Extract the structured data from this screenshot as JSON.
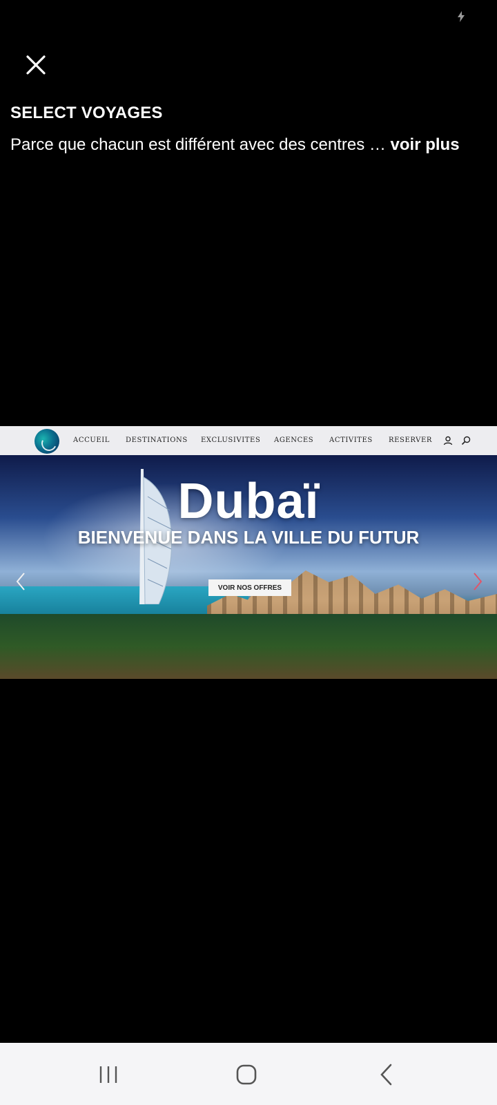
{
  "status_bar": {
    "icon": "flash-icon"
  },
  "viewer": {
    "close_icon": "close-icon",
    "title": "SELECT VOYAGES",
    "caption": "Parce que chacun est différent avec des centres",
    "ellipsis": "…",
    "more_label": "voir plus"
  },
  "website": {
    "nav_links": [
      "ACCUEIL",
      "DESTINATIONS",
      "EXCLUSIVITES",
      "AGENCES",
      "ACTIVITES",
      "RESERVER"
    ],
    "icons": [
      "user-icon",
      "search-icon"
    ],
    "hero": {
      "title": "Dubaï",
      "subtitle": "BIENVENUE DANS LA VILLE DU FUTUR",
      "cta_label": "VOIR NOS OFFRES",
      "accent_color": "#e0566a"
    }
  },
  "system_nav": {
    "buttons": [
      "recent-apps-icon",
      "home-icon",
      "back-icon"
    ],
    "background": "#f5f5f7"
  }
}
